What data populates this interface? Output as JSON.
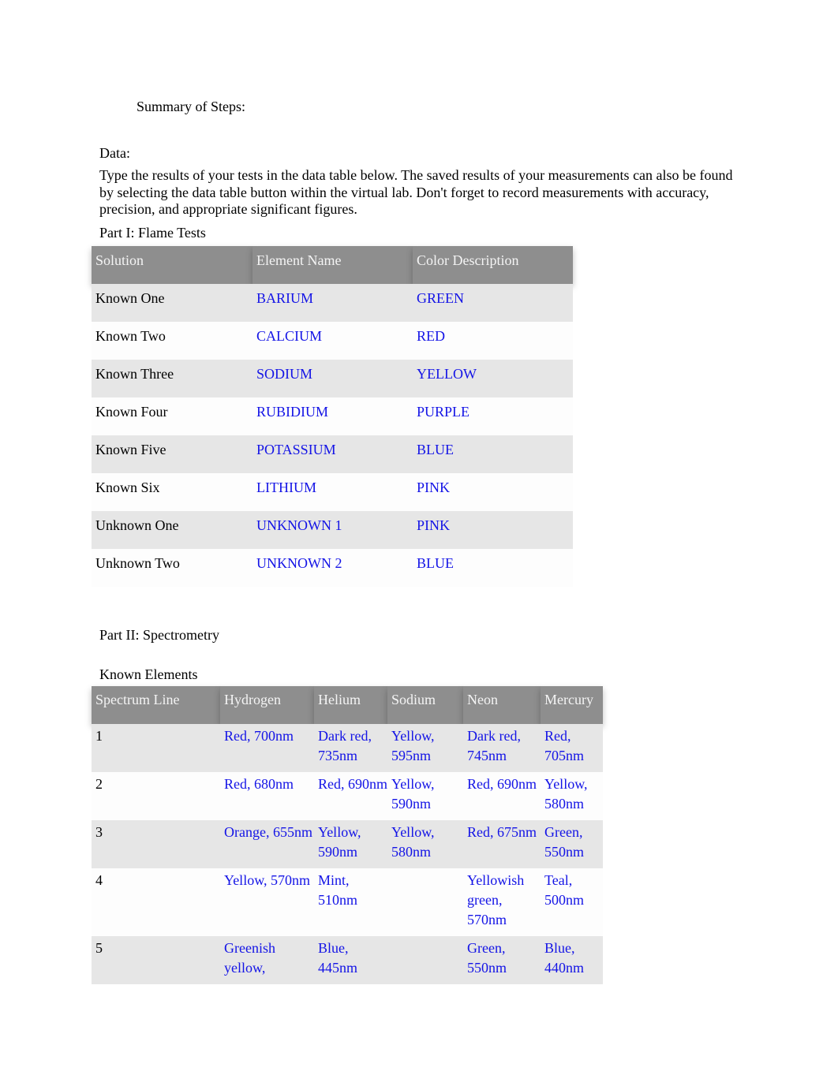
{
  "summary_heading": "Summary of Steps:",
  "data_heading": "Data:",
  "instructions": "Type the results of your tests in the data table below. The saved results of your measurements can also be found by selecting the data table button within the virtual lab. Don't forget to record measurements with accuracy, precision, and appropriate significant figures.",
  "part1": {
    "title": "Part I: Flame Tests",
    "headers": [
      "Solution",
      "Element Name",
      "Color Description"
    ],
    "rows": [
      {
        "solution": "Known One",
        "element": "BARIUM",
        "color": "GREEN"
      },
      {
        "solution": "Known Two",
        "element": "CALCIUM",
        "color": "RED"
      },
      {
        "solution": "Known Three",
        "element": "SODIUM",
        "color": "YELLOW"
      },
      {
        "solution": "Known Four",
        "element": "RUBIDIUM",
        "color": "PURPLE"
      },
      {
        "solution": "Known Five",
        "element": "POTASSIUM",
        "color": "BLUE"
      },
      {
        "solution": "Known Six",
        "element": "LITHIUM",
        "color": "PINK"
      },
      {
        "solution": "Unknown One",
        "element": "UNKNOWN 1",
        "color": "PINK"
      },
      {
        "solution": "Unknown Two",
        "element": "UNKNOWN 2",
        "color": "BLUE"
      }
    ]
  },
  "part2": {
    "title": "Part II: Spectrometry",
    "subtitle": "Known Elements",
    "headers": [
      "Spectrum Line",
      "Hydrogen",
      "Helium",
      "Sodium",
      "Neon",
      "Mercury"
    ],
    "rows": [
      {
        "line": "1",
        "hydrogen": "Red, 700nm",
        "helium": "Dark red, 735nm",
        "sodium": "Yellow, 595nm",
        "neon": "Dark red, 745nm",
        "mercury": "Red, 705nm"
      },
      {
        "line": "2",
        "hydrogen": "Red, 680nm",
        "helium": "Red, 690nm",
        "sodium": "Yellow, 590nm",
        "neon": "Red, 690nm",
        "mercury": "Yellow, 580nm"
      },
      {
        "line": "3",
        "hydrogen": "Orange, 655nm",
        "helium": "Yellow, 590nm",
        "sodium": "Yellow, 580nm",
        "neon": "Red, 675nm",
        "mercury": "Green, 550nm"
      },
      {
        "line": "4",
        "hydrogen": "Yellow, 570nm",
        "helium": "Mint, 510nm",
        "sodium": "",
        "neon": "Yellowish green, 570nm",
        "mercury": "Teal, 500nm"
      },
      {
        "line": "5",
        "hydrogen": "Greenish yellow,",
        "helium": "Blue, 445nm",
        "sodium": "",
        "neon": "Green, 550nm",
        "mercury": "Blue, 440nm"
      }
    ]
  }
}
